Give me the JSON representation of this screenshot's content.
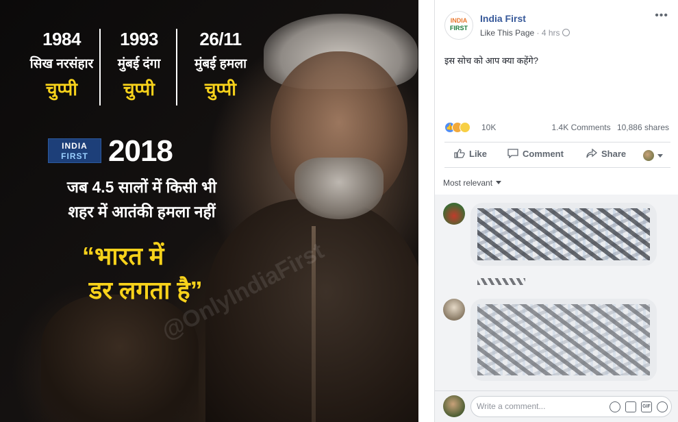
{
  "image": {
    "columns": [
      {
        "year": "1984",
        "event": "सिख नरसंहार",
        "silence": "चुप्पी"
      },
      {
        "year": "1993",
        "event": "मुंबई दंगा",
        "silence": "चुप्पी"
      },
      {
        "year": "26/11",
        "event": "मुंबई हमला",
        "silence": "चुप्पी"
      }
    ],
    "logo_line1": "INDIA",
    "logo_line2": "FIRST",
    "year_2018": "2018",
    "line1": "जब 4.5 सालों में किसी भी",
    "line2": "शहर में आतंकी हमला नहीं",
    "quote_line1": "“भारत में",
    "quote_line2": "डर लगता है”",
    "watermark": "@OnlyIndiaFirst"
  },
  "post": {
    "avatar_line1": "INDIA",
    "avatar_line2": "FIRST",
    "page_name": "India First",
    "like_page": "Like This Page",
    "separator": " · ",
    "time": "4 hrs",
    "text": "इस सोच को आप क्या कहेंगे?",
    "reaction_count": "10K",
    "comments_count": "1.4K Comments",
    "shares_count": "10,886 shares",
    "actions": {
      "like": "Like",
      "comment": "Comment",
      "share": "Share"
    },
    "sort_label": "Most relevant",
    "write_placeholder": "Write a comment...",
    "gif_label": "GIF"
  },
  "colors": {
    "accent_yellow": "#f7d21b",
    "link_blue": "#365899",
    "meta_gray": "#90949c"
  }
}
